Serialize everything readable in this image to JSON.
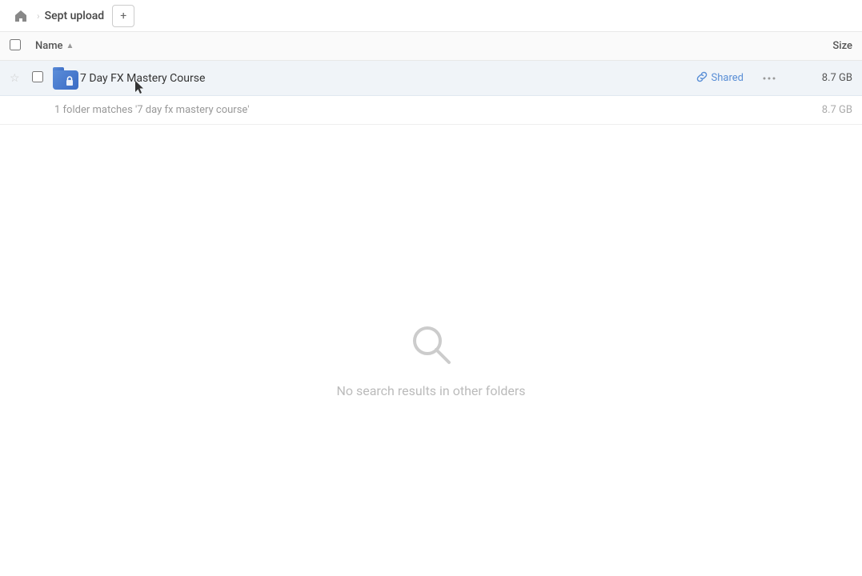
{
  "breadcrumb": {
    "home_label": "Home",
    "separator": "›",
    "current_folder": "Sept upload",
    "add_button_label": "+"
  },
  "columns": {
    "name_label": "Name",
    "sort_indicator": "▲",
    "size_label": "Size"
  },
  "file_item": {
    "name": "7 Day FX Mastery Course",
    "shared_label": "Shared",
    "size": "8.7 GB",
    "is_starred": false
  },
  "summary": {
    "text": "1 folder matches '7 day fx mastery course'",
    "size": "8.7 GB"
  },
  "empty_state": {
    "message": "No search results in other folders"
  },
  "icons": {
    "home": "⌂",
    "star_empty": "☆",
    "link": "🔗",
    "more": "•••",
    "lock": "🔒",
    "search": "search-icon"
  }
}
